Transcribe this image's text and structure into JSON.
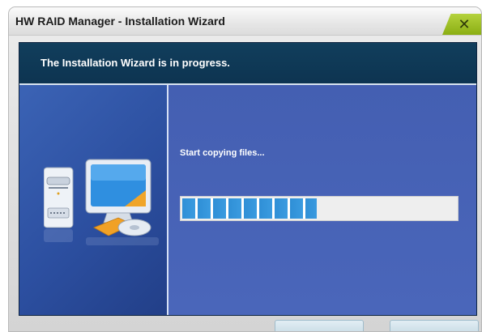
{
  "window": {
    "title": "HW RAID Manager - Installation Wizard"
  },
  "header": {
    "text": "The Installation Wizard is in progress."
  },
  "status": {
    "text": "Start copying files..."
  },
  "progress": {
    "percent": 49
  },
  "buttons": {
    "back_label": "",
    "next_label": ""
  },
  "icons": {
    "close": "close-icon",
    "illustration": "computer-install-icon"
  },
  "colors": {
    "header_bg": "#0d3451",
    "panel_bg": "#445fb2",
    "progress_fill": "#2f8fd6",
    "close_tab": "#9cc21e"
  }
}
